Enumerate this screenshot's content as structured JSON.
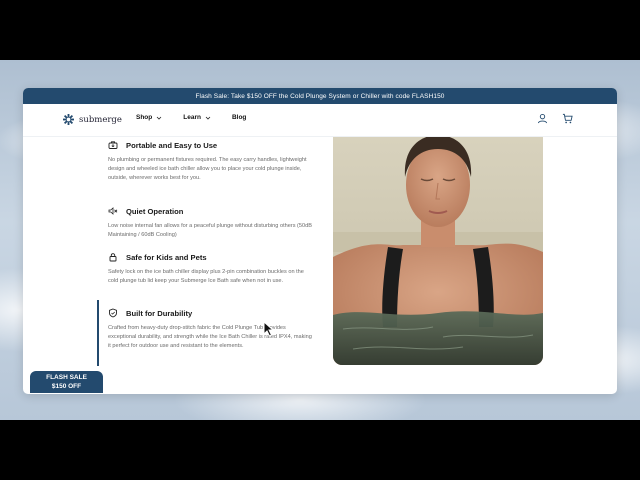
{
  "promo_bar": {
    "text": "Flash Sale: Take $150 OFF the Cold Plunge System or Chiller with code FLASH150"
  },
  "brand": {
    "name": "submerge",
    "color": "#234a6e"
  },
  "nav": {
    "items": [
      {
        "label": "Shop",
        "has_dropdown": true
      },
      {
        "label": "Learn",
        "has_dropdown": true
      },
      {
        "label": "Blog",
        "has_dropdown": false
      }
    ],
    "icons": [
      "account-icon",
      "cart-icon"
    ]
  },
  "features": [
    {
      "icon": "briefcase-icon",
      "title": "Portable and Easy to Use",
      "desc": "No plumbing or permanent fixtures required. The easy carry handles, lightweight design and wheeled ice bath chiller allow you to place your cold plunge inside, outside, wherever works best for you."
    },
    {
      "icon": "mute-icon",
      "title": "Quiet Operation",
      "desc": "Low noise internal fan allows for a peaceful plunge without disturbing others (50dB Maintaining / 60dB Cooling)"
    },
    {
      "icon": "lock-icon",
      "title": "Safe for Kids and Pets",
      "desc": "Safety lock on the ice bath chiller display plus 2-pin combination buckles on the cold plunge tub lid keep your Submerge Ice Bath safe when not in use."
    },
    {
      "icon": "shield-icon",
      "title": "Built for Durability",
      "desc": "Crafted from heavy-duty drop-stitch fabric the Cold Plunge Tub provides exceptional durability, and strength while the Ice Bath Chiller is rated IPX4, making it perfect for outdoor use and resistant to the elements.",
      "active": true
    }
  ],
  "flash_badge": {
    "line1": "FLASH SALE",
    "line2": "$150 OFF"
  }
}
